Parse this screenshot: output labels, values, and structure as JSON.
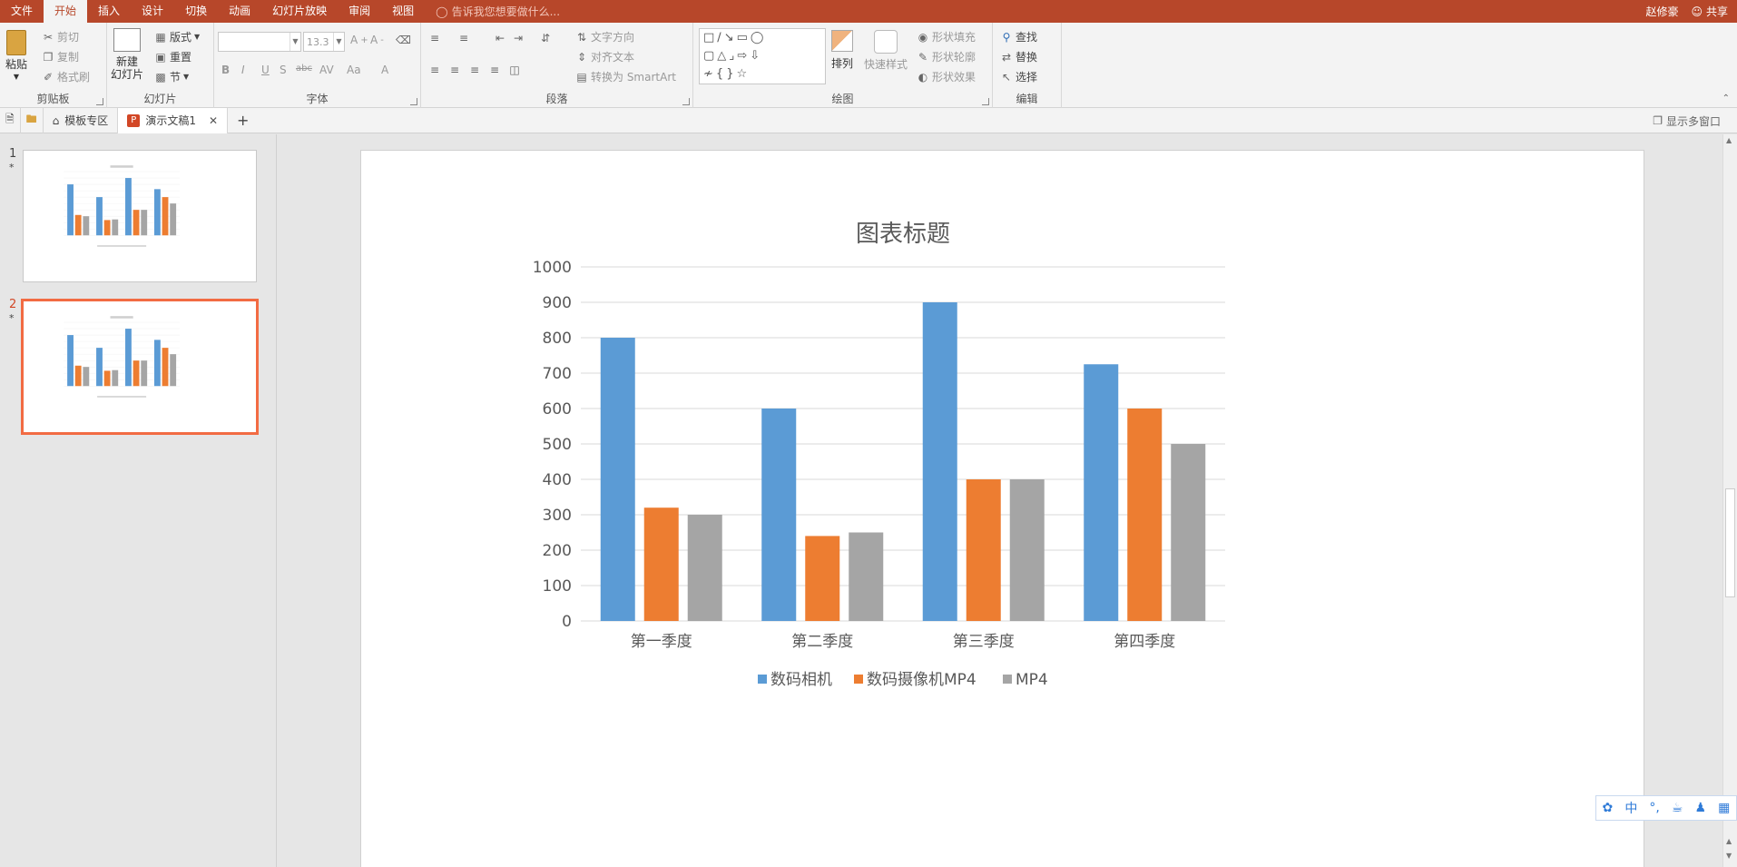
{
  "menu": {
    "tabs": [
      {
        "label": "文件",
        "active": false
      },
      {
        "label": "开始",
        "active": true
      },
      {
        "label": "插入",
        "active": false
      },
      {
        "label": "设计",
        "active": false
      },
      {
        "label": "切换",
        "active": false
      },
      {
        "label": "动画",
        "active": false
      },
      {
        "label": "幻灯片放映",
        "active": false
      },
      {
        "label": "审阅",
        "active": false
      },
      {
        "label": "视图",
        "active": false
      }
    ],
    "tell_me": "告诉我您想要做什么...",
    "user": "赵修豪",
    "share": "共享"
  },
  "ribbon": {
    "clipboard": {
      "label": "剪贴板",
      "paste": "粘贴",
      "cut": "剪切",
      "copy": "复制",
      "format_painter": "格式刷"
    },
    "slides": {
      "label": "幻灯片",
      "new_slide_1": "新建",
      "new_slide_2": "幻灯片",
      "layout": "版式",
      "reset": "重置",
      "section": "节"
    },
    "font": {
      "label": "字体",
      "font_name": "",
      "font_size": "13.3"
    },
    "paragraph": {
      "label": "段落",
      "text_direction": "文字方向",
      "align_text": "对齐文本",
      "smartart": "转换为 SmartArt"
    },
    "drawing": {
      "label": "绘图",
      "arrange": "排列",
      "quick_styles": "快速样式",
      "shape_fill": "形状填充",
      "shape_outline": "形状轮廓",
      "shape_effects": "形状效果"
    },
    "editing": {
      "label": "编辑",
      "find": "查找",
      "replace": "替换",
      "select": "选择"
    }
  },
  "docbar": {
    "template_tab": "模板专区",
    "doc_tab": "演示文稿1",
    "multi_window": "显示多窗口"
  },
  "slides": [
    {
      "number": "1",
      "star": "*",
      "selected": false
    },
    {
      "number": "2",
      "star": "*",
      "selected": true
    }
  ],
  "ime": {
    "lang": "中"
  },
  "colors": {
    "accent": "#b7472a",
    "series1": "#5b9bd5",
    "series2": "#ed7d31",
    "series3": "#a5a5a5",
    "selection": "#f26b43"
  },
  "chart_data": {
    "type": "bar",
    "title": "图表标题",
    "categories": [
      "第一季度",
      "第二季度",
      "第三季度",
      "第四季度"
    ],
    "series": [
      {
        "name": "数码相机",
        "values": [
          800,
          600,
          900,
          725
        ]
      },
      {
        "name": "数码摄像机MP4",
        "values": [
          320,
          240,
          400,
          600
        ]
      },
      {
        "name": "MP4",
        "values": [
          300,
          250,
          400,
          500
        ]
      }
    ],
    "ylim": [
      0,
      1000
    ],
    "yticks": [
      0,
      100,
      200,
      300,
      400,
      500,
      600,
      700,
      800,
      900,
      1000
    ],
    "grid": true,
    "legend": "bottom"
  }
}
